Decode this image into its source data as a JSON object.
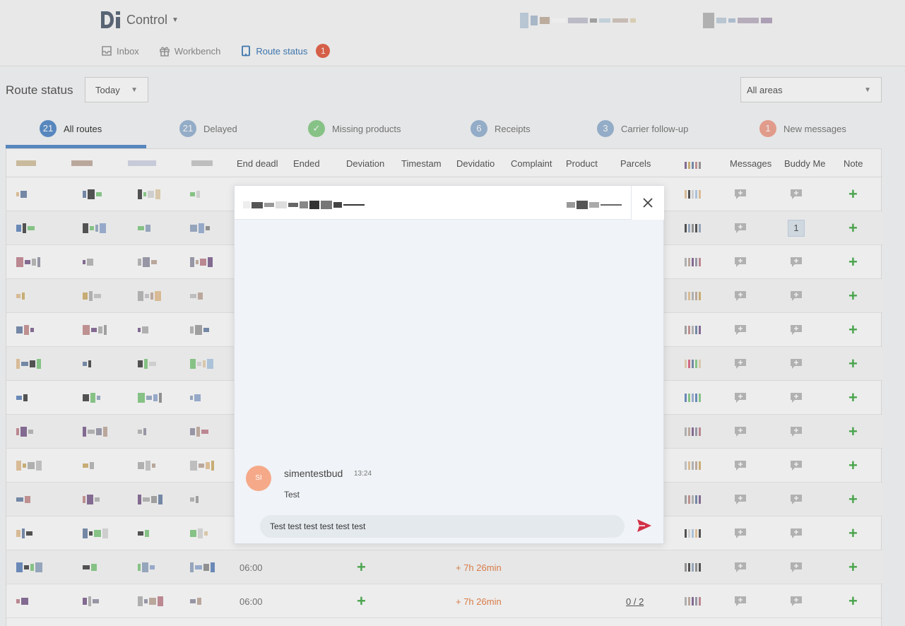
{
  "header": {
    "app_name": "Control",
    "nav": [
      {
        "label": "Inbox",
        "icon": "inbox-icon"
      },
      {
        "label": "Workbench",
        "icon": "gift-icon"
      },
      {
        "label": "Route status",
        "icon": "tablet-icon",
        "badge": "1",
        "active": true
      }
    ]
  },
  "toolbar": {
    "title": "Route status",
    "day_select": "Today",
    "area_select": "All areas"
  },
  "tabs": [
    {
      "count": "21",
      "label": "All routes",
      "color": "#5b8fcc"
    },
    {
      "count": "21",
      "label": "Delayed",
      "color": "#9db8d6"
    },
    {
      "count": "✓",
      "label": "Missing products",
      "color": "#8ed08e"
    },
    {
      "count": "6",
      "label": "Receipts",
      "color": "#9db8d6"
    },
    {
      "count": "3",
      "label": "Carrier follow-up",
      "color": "#9db8d6"
    },
    {
      "count": "1",
      "label": "New messages",
      "color": "#f2a593"
    }
  ],
  "table": {
    "headers": [
      "End deadl",
      "Ended",
      "Deviation",
      "Timestam",
      "Devidatio",
      "Complaint",
      "Product",
      "Parcels",
      "Messages",
      "Buddy Me",
      "Note"
    ],
    "rows": [
      {
        "buddy_count": ""
      },
      {
        "buddy_count": "1"
      },
      {
        "buddy_count": ""
      },
      {
        "buddy_count": ""
      },
      {
        "buddy_count": ""
      },
      {
        "buddy_count": ""
      },
      {
        "buddy_count": ""
      },
      {
        "buddy_count": ""
      },
      {
        "buddy_count": ""
      },
      {
        "buddy_count": ""
      },
      {
        "buddy_count": ""
      },
      {
        "buddy_count": "",
        "end_deadline": "06:00",
        "deviation": "+ 7h 26min"
      },
      {
        "buddy_count": "",
        "end_deadline": "06:00",
        "deviation": "+ 7h 26min",
        "parcels": "0 / 2"
      }
    ]
  },
  "chat": {
    "messages": [
      {
        "initials": "SI",
        "author": "simentestbud",
        "time": "13:24",
        "text": "Test"
      }
    ],
    "input_value": "Test test test test test test",
    "colors": {
      "avatar": "#f5a989",
      "send": "#d32f45"
    }
  }
}
